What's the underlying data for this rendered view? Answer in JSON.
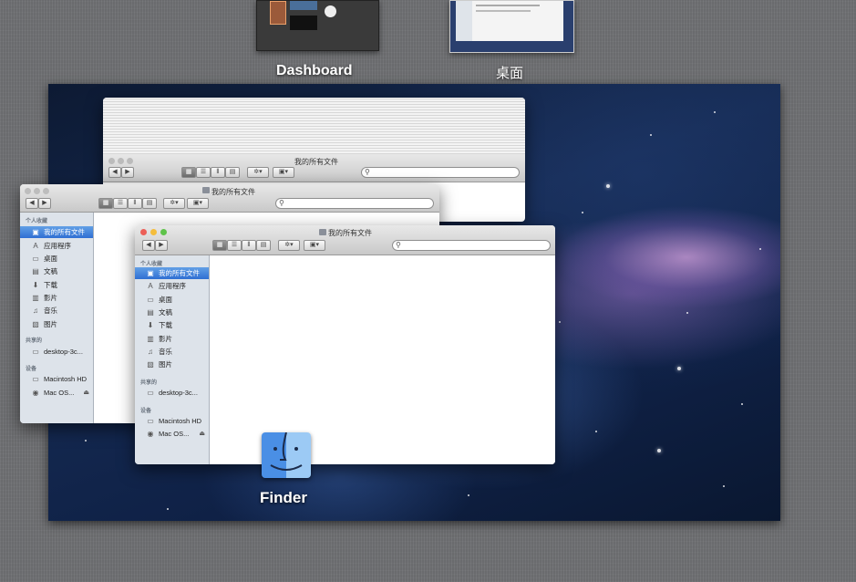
{
  "spaces": {
    "dashboard_label": "Dashboard",
    "desktop_label": "桌面"
  },
  "app_label": "Finder",
  "window_title": "我的所有文件",
  "toolbar": {
    "back": "◀",
    "forward": "▶",
    "view_icon": "▦",
    "view_list": "☰",
    "view_columns": "⫴",
    "view_coverflow": "▤",
    "action": "✲▾",
    "arrange": "▣▾",
    "search_icon": "⚲"
  },
  "sidebar": {
    "favorites_header": "个人收藏",
    "favorites": [
      {
        "label": "我的所有文件",
        "icon": "all-files-icon",
        "glyph": "▣"
      },
      {
        "label": "应用程序",
        "icon": "applications-icon",
        "glyph": "A"
      },
      {
        "label": "桌面",
        "icon": "desktop-icon",
        "glyph": "▭"
      },
      {
        "label": "文稿",
        "icon": "documents-icon",
        "glyph": "▤"
      },
      {
        "label": "下载",
        "icon": "downloads-icon",
        "glyph": "⬇"
      },
      {
        "label": "影片",
        "icon": "movies-icon",
        "glyph": "▥"
      },
      {
        "label": "音乐",
        "icon": "music-icon",
        "glyph": "♫"
      },
      {
        "label": "图片",
        "icon": "pictures-icon",
        "glyph": "▧"
      }
    ],
    "shared_header": "共享的",
    "shared": [
      {
        "label": "desktop-3c...",
        "icon": "computer-icon",
        "glyph": "▭"
      }
    ],
    "devices_header": "设备",
    "devices": [
      {
        "label": "Macintosh HD",
        "icon": "hard-drive-icon",
        "glyph": "▭"
      },
      {
        "label": "Mac OS...",
        "icon": "disc-icon",
        "glyph": "◉",
        "eject": "⏏"
      }
    ]
  },
  "colors": {
    "traffic_close": "#ec5f57",
    "traffic_min": "#f5bd3c",
    "traffic_max": "#5fc34a",
    "selection": "#3a7bd8"
  }
}
